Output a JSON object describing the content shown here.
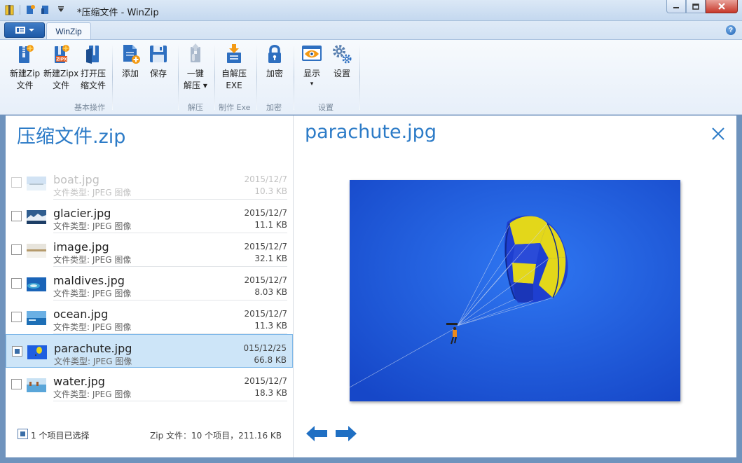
{
  "window": {
    "title": "*压缩文件 - WinZip",
    "controls": [
      "minimize",
      "maximize",
      "close"
    ]
  },
  "ribbon": {
    "app_menu_icon": "app-menu-icon",
    "tab_label": "WinZip",
    "help_label": "?",
    "buttons": {
      "new_zip": {
        "line1": "新建Zip",
        "line2": "文件"
      },
      "new_zipx": {
        "line1": "新建Zipx",
        "line2": "文件",
        "badge": "ZIPX"
      },
      "open_archive": {
        "line1": "打开压",
        "line2": "缩文件"
      },
      "add": {
        "line1": "添加"
      },
      "save": {
        "line1": "保存"
      },
      "unzip": {
        "line1": "一键",
        "line2": "解压 ▾"
      },
      "self_extract": {
        "line1": "自解压",
        "line2": "EXE"
      },
      "encrypt": {
        "line1": "加密"
      },
      "view": {
        "line1": "显示",
        "line2": "▾"
      },
      "settings": {
        "line1": "设置"
      }
    },
    "groups": {
      "basic": "基本操作",
      "extract": "解压",
      "make_exe": "制作 Exe",
      "encrypt": "加密",
      "settings": "设置"
    }
  },
  "archive": {
    "name": "压缩文件.zip",
    "files": [
      {
        "name": "boat.jpg",
        "type": "文件类型: JPEG 图像",
        "date": "2015/12/7",
        "size": "10.3 KB",
        "checked": false,
        "faded": true
      },
      {
        "name": "glacier.jpg",
        "type": "文件类型: JPEG 图像",
        "date": "2015/12/7",
        "size": "11.1 KB",
        "checked": false
      },
      {
        "name": "image.jpg",
        "type": "文件类型: JPEG 图像",
        "date": "2015/12/7",
        "size": "32.1 KB",
        "checked": false
      },
      {
        "name": "maldives.jpg",
        "type": "文件类型: JPEG 图像",
        "date": "2015/12/7",
        "size": "8.03 KB",
        "checked": false
      },
      {
        "name": "ocean.jpg",
        "type": "文件类型: JPEG 图像",
        "date": "2015/12/7",
        "size": "11.3 KB",
        "checked": false
      },
      {
        "name": "parachute.jpg",
        "type": "文件类型: JPEG 图像",
        "date": "015/12/25",
        "size": "66.8 KB",
        "checked": true
      },
      {
        "name": "water.jpg",
        "type": "文件类型: JPEG 图像",
        "date": "2015/12/7",
        "size": "18.3 KB",
        "checked": false
      }
    ],
    "status": {
      "selected": "1 个项目已选择",
      "summary": "Zip 文件：10 个项目，211.16 KB"
    }
  },
  "preview": {
    "filename": "parachute.jpg",
    "close_icon": "close-icon",
    "prev_icon": "arrow-left-icon",
    "next_icon": "arrow-right-icon"
  },
  "colors": {
    "accent": "#2c7bc7",
    "selection": "#cde5f8",
    "sky": "#1f5fe0"
  }
}
